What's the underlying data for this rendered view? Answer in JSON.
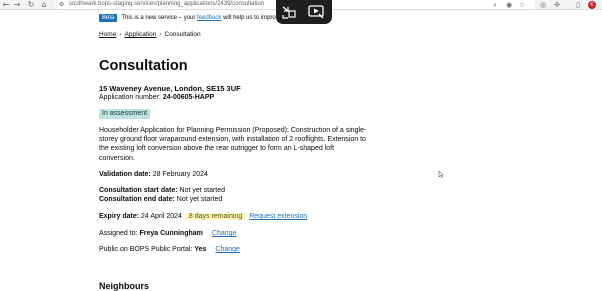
{
  "browser": {
    "url": "southwark.bops-staging.services/planning_applications/2439/consultation",
    "icons": [
      "back-icon",
      "forward-icon",
      "reload-icon",
      "home-icon",
      "site-info-icon",
      "search-icon",
      "eye-off-icon",
      "bookmark-star-icon",
      "extension-icon",
      "puzzle-icon",
      "sidebar-icon",
      "profile-avatar"
    ],
    "avatar_letter": "K"
  },
  "banner": {
    "tag": "Beta",
    "text_before": "This is a new service – your",
    "link": "feedback",
    "text_after": "will help us to impro"
  },
  "breadcrumb": {
    "items": [
      "Home",
      "Application",
      "Consultation"
    ]
  },
  "page": {
    "title": "Consultation",
    "address": "15 Waveney Avenue, London, SE15 3UF",
    "application_number_label": "Application number:",
    "application_number": "24-00605-HAPP",
    "status": "In assessment",
    "description": "Householder Application for Planning Permission (Proposed): Construction of a single-storey ground floor wraparound extension, with installation of 2 rooflights. Extension to the existing loft conversion above the rear outrigger to form an L-shaped loft conversion.",
    "validation_label": "Validation date:",
    "validation_date": "28 February 2024",
    "consultation_start_label": "Consultation start date:",
    "consultation_start": "Not yet started",
    "consultation_end_label": "Consultation end date:",
    "consultation_end": "Not yet started",
    "expiry_label": "Expiry date:",
    "expiry_date": "24 April 2024",
    "days_remaining": "8 days remaining",
    "request_extension": "Request extension",
    "assigned_label": "Assigned to:",
    "assigned_to": "Freya Cunningham",
    "change": "Change",
    "public_label": "Public on BOPS Public Portal:",
    "public_value": "Yes",
    "neighbours_heading": "Neighbours"
  },
  "colors": {
    "link": "#1d70b8",
    "status_tag_bg": "#bfe3e0",
    "warning_tag_bg": "#fff7bf",
    "beta_tag_bg": "#1d70b8"
  }
}
